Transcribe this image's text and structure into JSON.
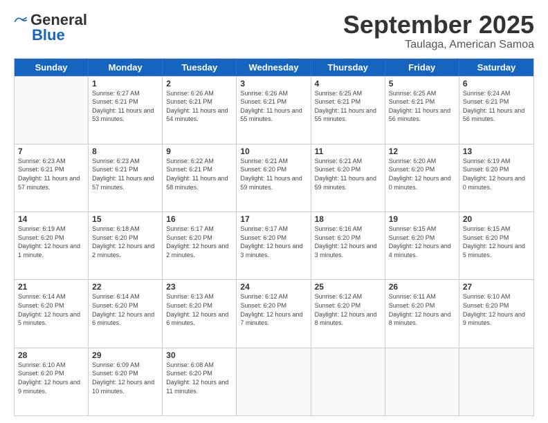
{
  "logo": {
    "general": "General",
    "blue": "Blue"
  },
  "title": {
    "month": "September 2025",
    "location": "Taulaga, American Samoa"
  },
  "header_days": [
    "Sunday",
    "Monday",
    "Tuesday",
    "Wednesday",
    "Thursday",
    "Friday",
    "Saturday"
  ],
  "weeks": [
    [
      {
        "day": "",
        "sunrise": "",
        "sunset": "",
        "daylight": ""
      },
      {
        "day": "1",
        "sunrise": "Sunrise: 6:27 AM",
        "sunset": "Sunset: 6:21 PM",
        "daylight": "Daylight: 11 hours and 53 minutes."
      },
      {
        "day": "2",
        "sunrise": "Sunrise: 6:26 AM",
        "sunset": "Sunset: 6:21 PM",
        "daylight": "Daylight: 11 hours and 54 minutes."
      },
      {
        "day": "3",
        "sunrise": "Sunrise: 6:26 AM",
        "sunset": "Sunset: 6:21 PM",
        "daylight": "Daylight: 11 hours and 55 minutes."
      },
      {
        "day": "4",
        "sunrise": "Sunrise: 6:25 AM",
        "sunset": "Sunset: 6:21 PM",
        "daylight": "Daylight: 11 hours and 55 minutes."
      },
      {
        "day": "5",
        "sunrise": "Sunrise: 6:25 AM",
        "sunset": "Sunset: 6:21 PM",
        "daylight": "Daylight: 11 hours and 56 minutes."
      },
      {
        "day": "6",
        "sunrise": "Sunrise: 6:24 AM",
        "sunset": "Sunset: 6:21 PM",
        "daylight": "Daylight: 11 hours and 56 minutes."
      }
    ],
    [
      {
        "day": "7",
        "sunrise": "Sunrise: 6:23 AM",
        "sunset": "Sunset: 6:21 PM",
        "daylight": "Daylight: 11 hours and 57 minutes."
      },
      {
        "day": "8",
        "sunrise": "Sunrise: 6:23 AM",
        "sunset": "Sunset: 6:21 PM",
        "daylight": "Daylight: 11 hours and 57 minutes."
      },
      {
        "day": "9",
        "sunrise": "Sunrise: 6:22 AM",
        "sunset": "Sunset: 6:21 PM",
        "daylight": "Daylight: 11 hours and 58 minutes."
      },
      {
        "day": "10",
        "sunrise": "Sunrise: 6:21 AM",
        "sunset": "Sunset: 6:20 PM",
        "daylight": "Daylight: 11 hours and 59 minutes."
      },
      {
        "day": "11",
        "sunrise": "Sunrise: 6:21 AM",
        "sunset": "Sunset: 6:20 PM",
        "daylight": "Daylight: 11 hours and 59 minutes."
      },
      {
        "day": "12",
        "sunrise": "Sunrise: 6:20 AM",
        "sunset": "Sunset: 6:20 PM",
        "daylight": "Daylight: 12 hours and 0 minutes."
      },
      {
        "day": "13",
        "sunrise": "Sunrise: 6:19 AM",
        "sunset": "Sunset: 6:20 PM",
        "daylight": "Daylight: 12 hours and 0 minutes."
      }
    ],
    [
      {
        "day": "14",
        "sunrise": "Sunrise: 6:19 AM",
        "sunset": "Sunset: 6:20 PM",
        "daylight": "Daylight: 12 hours and 1 minute."
      },
      {
        "day": "15",
        "sunrise": "Sunrise: 6:18 AM",
        "sunset": "Sunset: 6:20 PM",
        "daylight": "Daylight: 12 hours and 2 minutes."
      },
      {
        "day": "16",
        "sunrise": "Sunrise: 6:17 AM",
        "sunset": "Sunset: 6:20 PM",
        "daylight": "Daylight: 12 hours and 2 minutes."
      },
      {
        "day": "17",
        "sunrise": "Sunrise: 6:17 AM",
        "sunset": "Sunset: 6:20 PM",
        "daylight": "Daylight: 12 hours and 3 minutes."
      },
      {
        "day": "18",
        "sunrise": "Sunrise: 6:16 AM",
        "sunset": "Sunset: 6:20 PM",
        "daylight": "Daylight: 12 hours and 3 minutes."
      },
      {
        "day": "19",
        "sunrise": "Sunrise: 6:15 AM",
        "sunset": "Sunset: 6:20 PM",
        "daylight": "Daylight: 12 hours and 4 minutes."
      },
      {
        "day": "20",
        "sunrise": "Sunrise: 6:15 AM",
        "sunset": "Sunset: 6:20 PM",
        "daylight": "Daylight: 12 hours and 5 minutes."
      }
    ],
    [
      {
        "day": "21",
        "sunrise": "Sunrise: 6:14 AM",
        "sunset": "Sunset: 6:20 PM",
        "daylight": "Daylight: 12 hours and 5 minutes."
      },
      {
        "day": "22",
        "sunrise": "Sunrise: 6:14 AM",
        "sunset": "Sunset: 6:20 PM",
        "daylight": "Daylight: 12 hours and 6 minutes."
      },
      {
        "day": "23",
        "sunrise": "Sunrise: 6:13 AM",
        "sunset": "Sunset: 6:20 PM",
        "daylight": "Daylight: 12 hours and 6 minutes."
      },
      {
        "day": "24",
        "sunrise": "Sunrise: 6:12 AM",
        "sunset": "Sunset: 6:20 PM",
        "daylight": "Daylight: 12 hours and 7 minutes."
      },
      {
        "day": "25",
        "sunrise": "Sunrise: 6:12 AM",
        "sunset": "Sunset: 6:20 PM",
        "daylight": "Daylight: 12 hours and 8 minutes."
      },
      {
        "day": "26",
        "sunrise": "Sunrise: 6:11 AM",
        "sunset": "Sunset: 6:20 PM",
        "daylight": "Daylight: 12 hours and 8 minutes."
      },
      {
        "day": "27",
        "sunrise": "Sunrise: 6:10 AM",
        "sunset": "Sunset: 6:20 PM",
        "daylight": "Daylight: 12 hours and 9 minutes."
      }
    ],
    [
      {
        "day": "28",
        "sunrise": "Sunrise: 6:10 AM",
        "sunset": "Sunset: 6:20 PM",
        "daylight": "Daylight: 12 hours and 9 minutes."
      },
      {
        "day": "29",
        "sunrise": "Sunrise: 6:09 AM",
        "sunset": "Sunset: 6:20 PM",
        "daylight": "Daylight: 12 hours and 10 minutes."
      },
      {
        "day": "30",
        "sunrise": "Sunrise: 6:08 AM",
        "sunset": "Sunset: 6:20 PM",
        "daylight": "Daylight: 12 hours and 11 minutes."
      },
      {
        "day": "",
        "sunrise": "",
        "sunset": "",
        "daylight": ""
      },
      {
        "day": "",
        "sunrise": "",
        "sunset": "",
        "daylight": ""
      },
      {
        "day": "",
        "sunrise": "",
        "sunset": "",
        "daylight": ""
      },
      {
        "day": "",
        "sunrise": "",
        "sunset": "",
        "daylight": ""
      }
    ]
  ]
}
